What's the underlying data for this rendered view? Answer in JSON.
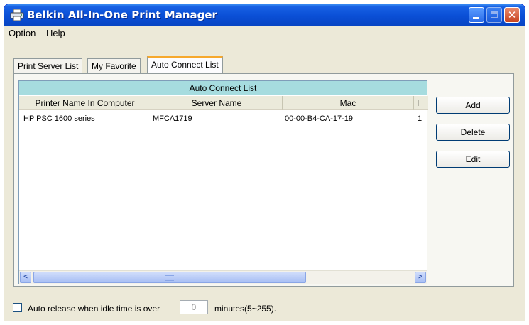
{
  "window": {
    "title": "Belkin All-In-One Print Manager",
    "app_icon": "printer-icon",
    "controls": {
      "minimize": "minimize-icon",
      "maximize": "maximize-icon",
      "close_label": "✕"
    }
  },
  "menu": {
    "items": [
      "Option",
      "Help"
    ]
  },
  "tabs": [
    "Print Server List",
    "My Favorite",
    "Auto Connect List"
  ],
  "active_tab": "Auto Connect List",
  "list": {
    "caption": "Auto Connect List",
    "columns": [
      "Printer Name In Computer",
      "Server Name",
      "Mac",
      "I"
    ],
    "rows": [
      [
        "HP PSC 1600 series",
        "MFCA1719",
        "00-00-B4-CA-17-19",
        "1"
      ]
    ],
    "scroll_left": "<",
    "scroll_right": ">"
  },
  "buttons": {
    "add": "Add",
    "delete": "Delete",
    "edit": "Edit"
  },
  "footer": {
    "auto_release_label": "Auto release when idle time is over",
    "idle_value": "0",
    "minutes_label": "minutes(5~255).",
    "checked": false
  },
  "colors": {
    "titlebar": "#0a4fd6",
    "list_caption": "#a6dcdf",
    "active_tab_accent": "#f6a82c"
  }
}
